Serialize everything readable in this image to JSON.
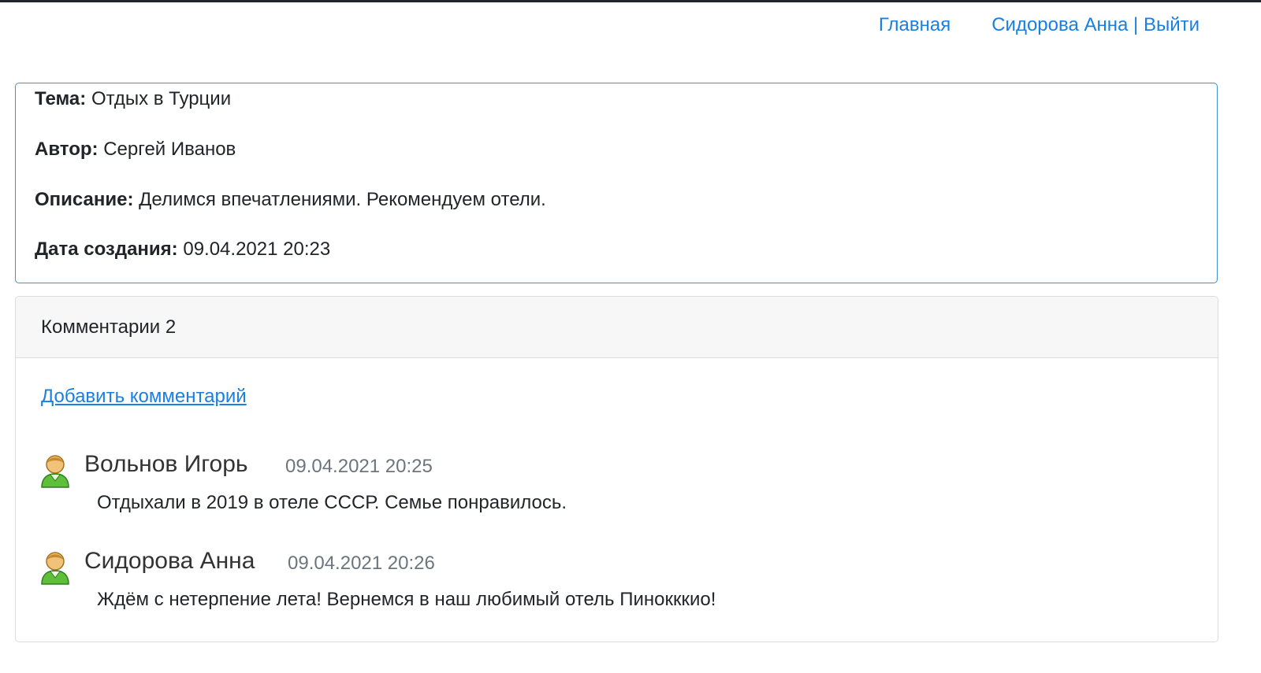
{
  "nav": {
    "home_label": "Главная",
    "user_name": "Сидорова Анна",
    "separator": " | ",
    "logout_label": "Выйти"
  },
  "topic": {
    "subject_label": "Тема:",
    "subject_value": "Отдых в Турции",
    "author_label": "Автор:",
    "author_value": "Сергей Иванов",
    "description_label": "Описание:",
    "description_value": "Делимся впечатлениями. Рекомендуем отели.",
    "created_label": "Дата создания:",
    "created_value": "09.04.2021 20:23"
  },
  "comments": {
    "header_label": "Комментарии",
    "count": "2",
    "add_label": "Добавить комментарий",
    "items": [
      {
        "author": "Вольнов Игорь",
        "date": "09.04.2021 20:25",
        "text": "Отдыхали в 2019 в отеле СССР. Семье понравилось.",
        "avatar_icon": "user-avatar-icon"
      },
      {
        "author": "Сидорова Анна",
        "date": "09.04.2021 20:26",
        "text": "Ждём с нетерпение лета! Вернемся в наш любимый отель Пинокккио!",
        "avatar_icon": "user-avatar-icon"
      }
    ]
  },
  "colors": {
    "link": "#1a7fe0",
    "topic_border": "#3d8fe0",
    "header_bg": "#f7f7f7",
    "muted": "#6c757d"
  }
}
